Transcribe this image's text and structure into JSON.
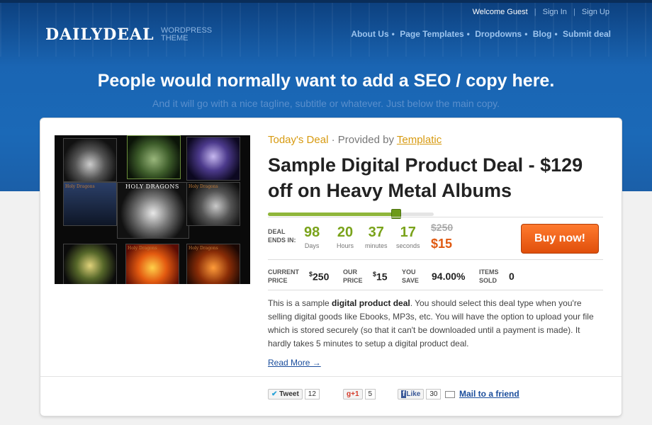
{
  "topbar": {
    "welcome": "Welcome Guest",
    "sep1": "|",
    "sign_in": "Sign In",
    "sep2": "|",
    "sign_up": "Sign Up"
  },
  "logo": {
    "name": "DAILYDEAL",
    "sub1": "WORDPRESS",
    "sub2": "THEME"
  },
  "nav": {
    "items": [
      "About Us",
      "Page Templates",
      "Dropdowns",
      "Blog",
      "Submit deal"
    ],
    "separator": "•"
  },
  "hero": {
    "headline": "People would normally want to add a SEO / copy here.",
    "tagline": "And it will go with a nice tagline, subtitle or whatever. Just below the main copy."
  },
  "artwork": {
    "album_title": "HOLY DRAGONS",
    "tile_caption": "Holy Dragons"
  },
  "deal": {
    "today_label": "Today's Deal",
    "provided_by": "· Provided by",
    "provider": "Templatic",
    "title": "Sample Digital Product Deal - $129 off on Heavy Metal Albums",
    "progress_fraction": 0.77,
    "ends_label_1": "DEAL",
    "ends_label_2": "ENDS IN:",
    "countdown": [
      {
        "value": "98",
        "unit": "Days"
      },
      {
        "value": "20",
        "unit": "Hours"
      },
      {
        "value": "37",
        "unit": "minutes"
      },
      {
        "value": "17",
        "unit": "seconds"
      }
    ],
    "old_price": "$250",
    "new_price": "$15",
    "buy_label": "Buy now!"
  },
  "stats": {
    "current": {
      "label1": "CURRENT",
      "label2": "PRICE",
      "symbol": "$",
      "value": "250"
    },
    "our": {
      "label1": "OUR",
      "label2": "PRICE",
      "symbol": "$",
      "value": "15"
    },
    "save": {
      "label1": "YOU",
      "label2": "SAVE",
      "value": "94.00%"
    },
    "sold": {
      "label1": "ITEMS",
      "label2": "SOLD",
      "value": "0"
    }
  },
  "description": {
    "p1": "This is a sample ",
    "bold": "digital product deal",
    "p2": ". You should select this deal type when you're selling digital goods like Ebooks, MP3s, etc. You will have the option to upload your file which is stored securely (so that it can't be downloaded until a payment is made). It hardly takes 5 minutes to setup a digital product deal."
  },
  "read_more": "Read More →",
  "share": {
    "tweet_label": "Tweet",
    "tweet_count": "12",
    "gplus_label": "+1",
    "gplus_count": "5",
    "like_label": "Like",
    "like_count": "30",
    "mail_label": "Mail to a friend"
  },
  "colors": {
    "brand_blue": "#1b69b7",
    "accent_orange": "#e05a12",
    "green": "#7aa31b",
    "gold": "#d79a10"
  }
}
